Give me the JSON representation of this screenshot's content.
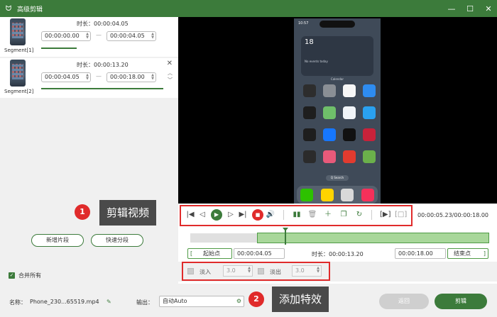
{
  "window": {
    "title": "高级剪辑"
  },
  "segments": [
    {
      "label": "Segment[1]",
      "duration_label": "时长：",
      "duration": "00:00:04.05",
      "start": "00:00:00.00",
      "end": "00:00:04.05"
    },
    {
      "label": "Segment[2]",
      "duration_label": "时长：",
      "duration": "00:00:13.20",
      "start": "00:00:04.05",
      "end": "00:00:18.00"
    }
  ],
  "left_actions": {
    "add_segment": "新增片段",
    "quick_split": "快速分段",
    "merge_all": "合并所有"
  },
  "callouts": {
    "one": {
      "num": "1",
      "text": "剪辑视频"
    },
    "two": {
      "num": "2",
      "text": "添加特效"
    }
  },
  "phone": {
    "status_time": "10:57",
    "widget_date": "18",
    "widget_no_events": "No events today",
    "widget_app": "Calendar",
    "search": "Q Search"
  },
  "player": {
    "time_display": "00:00:05.23/00:00:18.00"
  },
  "timeline": {
    "start_label": "起始点",
    "start_time": "00:00:04.05",
    "duration_label": "时长：",
    "duration": "00:00:13.20",
    "end_time": "00:00:18.00",
    "end_label": "结束点"
  },
  "effects": {
    "fade_in_label": "淡入",
    "fade_in_value": "3.0",
    "fade_out_label": "淡出",
    "fade_out_value": "3.0"
  },
  "bottom": {
    "name_label": "名称：",
    "name_value": "Phone_230...65519.mp4",
    "output_label": "输出：",
    "output_value": "自动Auto",
    "back_button": "返回",
    "edit_button": "剪辑"
  },
  "colors": {
    "brand": "#3c7b3b",
    "callout_red": "#e02b2b"
  }
}
